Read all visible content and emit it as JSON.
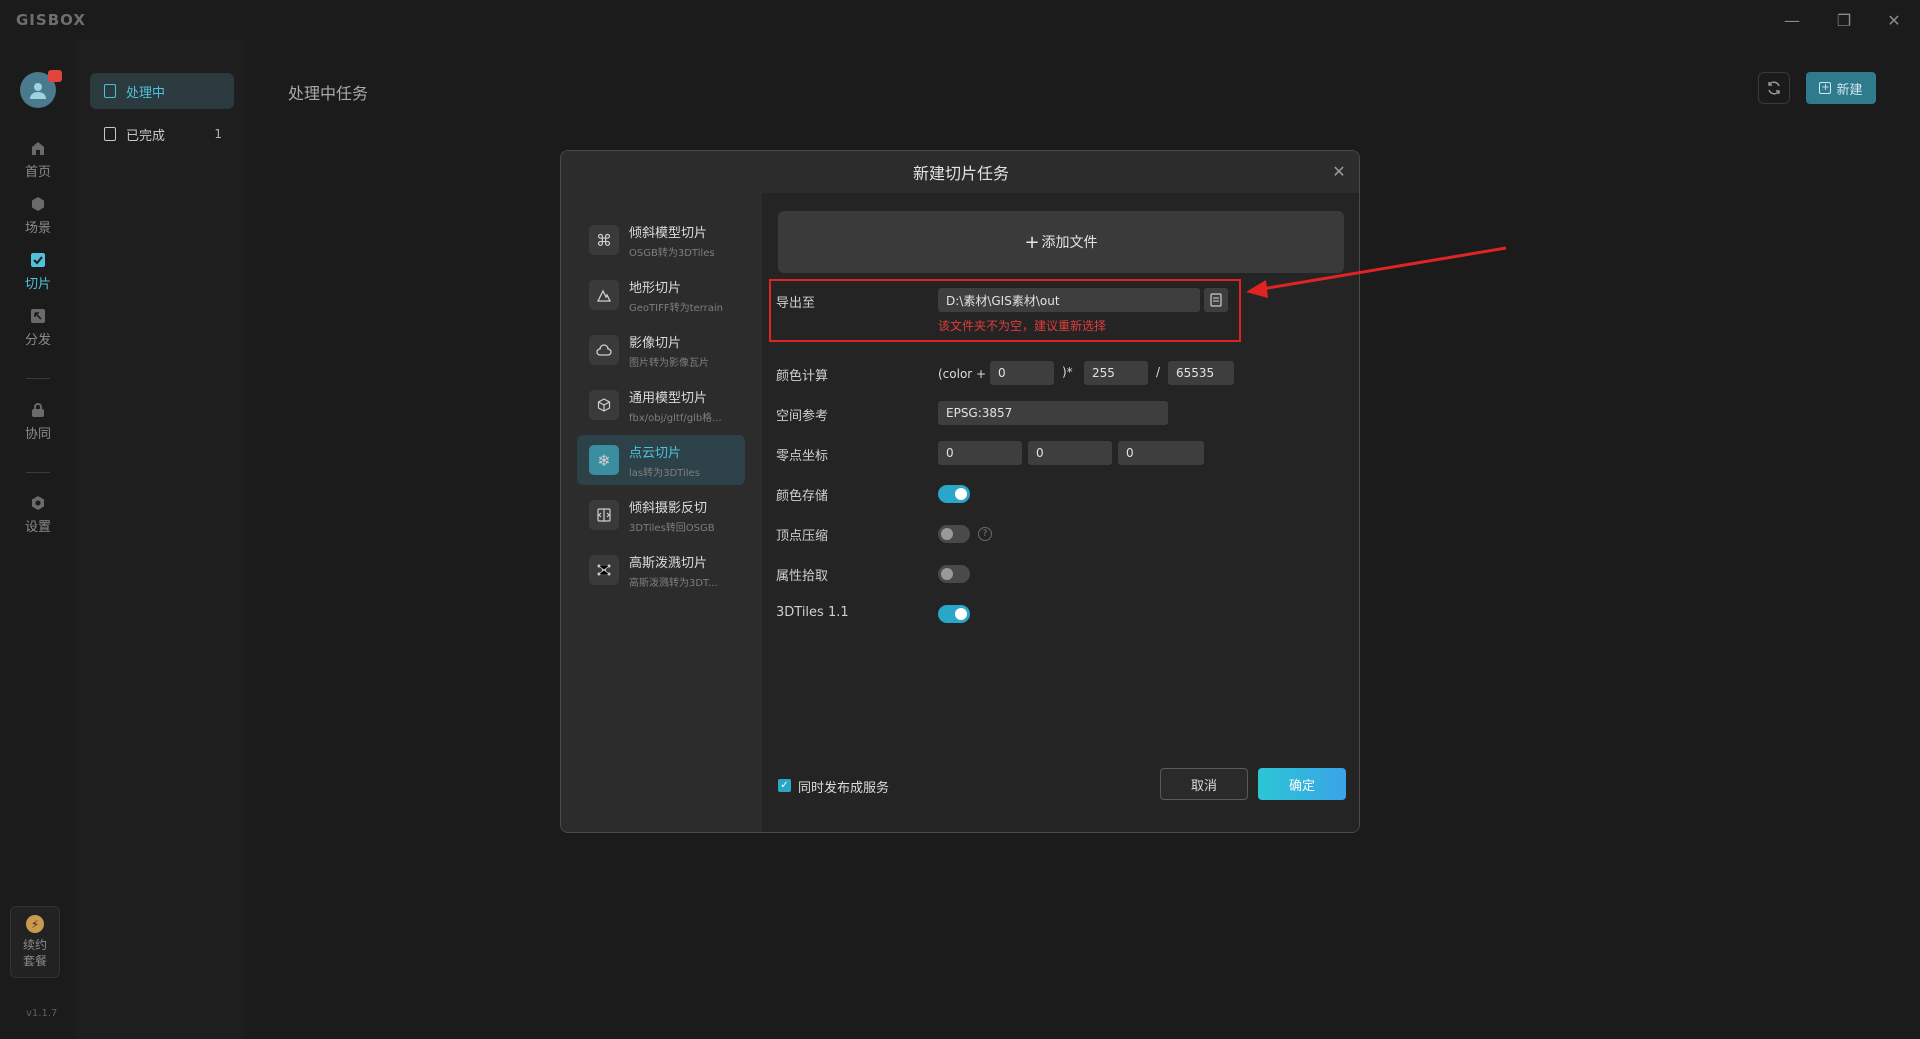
{
  "app": {
    "logo": "GISBOX",
    "version": "v1.1.7"
  },
  "window_controls": {
    "minimize": "—",
    "restore": "❐",
    "close": "✕"
  },
  "nav": {
    "items": [
      {
        "label": "首页",
        "icon": "home-icon"
      },
      {
        "label": "场景",
        "icon": "cube-icon"
      },
      {
        "label": "切片",
        "icon": "slice-icon"
      },
      {
        "label": "分发",
        "icon": "distribute-icon"
      },
      {
        "label": "协同",
        "icon": "lock-icon"
      },
      {
        "label": "设置",
        "icon": "gear-icon"
      }
    ],
    "active": "切片",
    "renew": {
      "label": "续约套餐",
      "icon": "lightning-icon"
    }
  },
  "sidebar": {
    "items": [
      {
        "label": "处理中",
        "count": ""
      },
      {
        "label": "已完成",
        "count": "1"
      }
    ]
  },
  "main": {
    "title": "处理中任务",
    "new_button": "新建"
  },
  "dialog": {
    "title": "新建切片任务",
    "types": [
      {
        "title": "倾斜模型切片",
        "sub": "OSGB转为3DTiles",
        "icon": "command-icon"
      },
      {
        "title": "地形切片",
        "sub": "GeoTIFF转为terrain",
        "icon": "mountain-icon"
      },
      {
        "title": "影像切片",
        "sub": "图片转为影像瓦片",
        "icon": "cloud-image-icon"
      },
      {
        "title": "通用模型切片",
        "sub": "fbx/obj/gltf/glb格...",
        "icon": "box-icon"
      },
      {
        "title": "点云切片",
        "sub": "las转为3DTiles",
        "icon": "snowflake-icon"
      },
      {
        "title": "倾斜摄影反切",
        "sub": "3DTiles转回OSGB",
        "icon": "reverse-icon"
      },
      {
        "title": "高斯泼溅切片",
        "sub": "高斯泼溅转为3DT...",
        "icon": "network-icon"
      }
    ],
    "active_type": "点云切片",
    "add_file": "添加文件",
    "export_label": "导出至",
    "export_path": "D:\\素材\\GIS素材\\out",
    "export_warning": "该文件夹不为空，建议重新选择",
    "color_calc": {
      "label": "颜色计算",
      "prefix": "(color +",
      "offset": "0",
      "mid": ")*",
      "multiplier": "255",
      "slash": "/",
      "divisor": "65535"
    },
    "spatial_ref": {
      "label": "空间参考",
      "value": "EPSG:3857"
    },
    "origin": {
      "label": "零点坐标",
      "x": "0",
      "y": "0",
      "z": "0"
    },
    "color_store": {
      "label": "颜色存储",
      "on": true
    },
    "vertex_compress": {
      "label": "顶点压缩",
      "on": false
    },
    "attr_pick": {
      "label": "属性拾取",
      "on": false
    },
    "tiles11": {
      "label": "3DTiles 1.1",
      "on": true
    },
    "publish_checkbox": "同时发布成服务",
    "cancel": "取消",
    "ok": "确定"
  },
  "colors": {
    "accent": "#4fc1d9",
    "highlight_box": "#e02424",
    "warning": "#e03c3c"
  }
}
